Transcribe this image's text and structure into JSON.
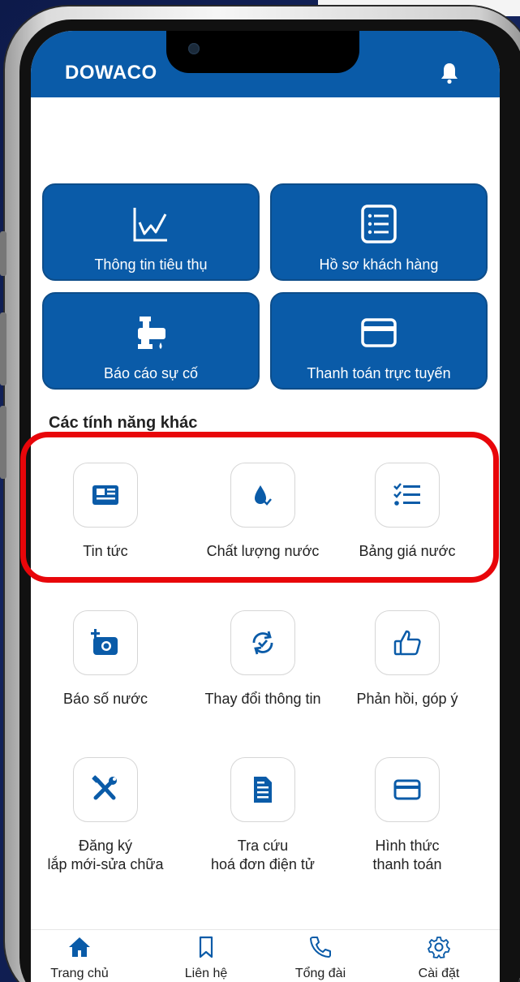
{
  "app": {
    "title": "DOWACO"
  },
  "tiles": [
    {
      "label": "Thông tin tiêu thụ",
      "icon": "chart-line-icon"
    },
    {
      "label": "Hồ sơ khách hàng",
      "icon": "list-document-icon"
    },
    {
      "label": "Báo cáo sự cố",
      "icon": "water-tap-icon"
    },
    {
      "label": "Thanh toán trực tuyến",
      "icon": "credit-card-icon"
    }
  ],
  "section": {
    "title": "Các tính năng khác"
  },
  "features": [
    {
      "label": "Tin tức",
      "icon": "newspaper-icon"
    },
    {
      "label": "Chất lượng nước",
      "icon": "water-drop-check-icon"
    },
    {
      "label": "Bảng giá nước",
      "icon": "checklist-icon"
    },
    {
      "label": "Báo số nước",
      "icon": "add-camera-icon"
    },
    {
      "label": "Thay đổi thông tin",
      "icon": "sync-check-icon"
    },
    {
      "label": "Phản hồi, góp ý",
      "icon": "thumbs-up-icon"
    },
    {
      "label_line1": "Đăng ký",
      "label_line2": "lắp mới-sửa chữa",
      "icon": "tools-icon"
    },
    {
      "label_line1": "Tra cứu",
      "label_line2": "hoá đơn điện tử",
      "icon": "invoice-icon"
    },
    {
      "label_line1": "Hình thức",
      "label_line2": "thanh toán",
      "icon": "card-icon"
    }
  ],
  "nav": [
    {
      "label": "Trang chủ",
      "icon": "home-icon"
    },
    {
      "label": "Liên hệ",
      "icon": "bookmark-icon"
    },
    {
      "label": "Tổng đài",
      "icon": "phone-icon"
    },
    {
      "label": "Cài đặt",
      "icon": "gear-icon"
    }
  ],
  "colors": {
    "primary": "#0a5ba8",
    "highlight": "#e8060a"
  }
}
